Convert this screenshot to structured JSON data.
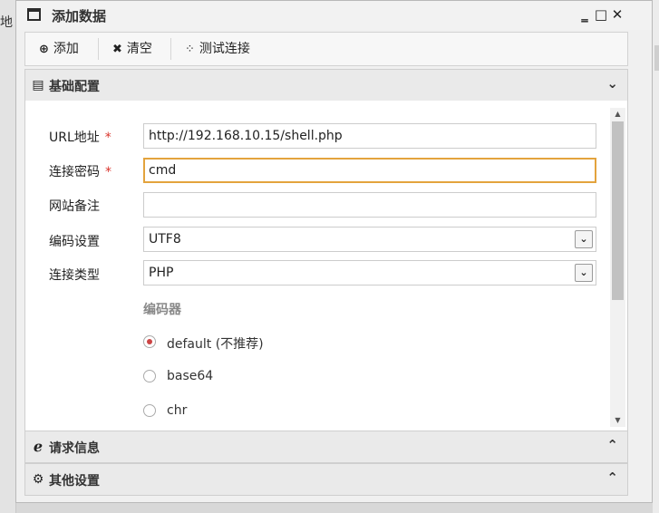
{
  "background": {
    "left_text": "地"
  },
  "window": {
    "title": "添加数据",
    "controls": {
      "minimize": "‗",
      "maximize": "□",
      "close": "✕"
    }
  },
  "toolbar": {
    "add": {
      "icon": "plus-circle-icon",
      "label": "添加"
    },
    "clear": {
      "icon": "x-icon",
      "label": "清空"
    },
    "test": {
      "icon": "spinner-icon",
      "label": "测试连接"
    }
  },
  "sections": {
    "basic": {
      "icon": "file-icon",
      "label": "基础配置",
      "state": "expanded"
    },
    "request": {
      "icon": "ie-icon",
      "label": "请求信息",
      "state": "collapsed"
    },
    "other": {
      "icon": "gears-icon",
      "label": "其他设置",
      "state": "collapsed"
    }
  },
  "form": {
    "url": {
      "label": "URL地址",
      "required_mark": "*",
      "value": "http://192.168.10.15/shell.php"
    },
    "password": {
      "label": "连接密码",
      "required_mark": "*",
      "value": "cmd"
    },
    "note": {
      "label": "网站备注",
      "value": ""
    },
    "encoding": {
      "label": "编码设置",
      "value": "UTF8"
    },
    "type": {
      "label": "连接类型",
      "value": "PHP"
    },
    "encoder": {
      "label": "编码器",
      "options": [
        {
          "label": "default (不推荐)",
          "checked": true
        },
        {
          "label": "base64",
          "checked": false
        },
        {
          "label": "chr",
          "checked": false
        }
      ]
    }
  },
  "colors": {
    "accent_focus": "#e3a33d",
    "required": "#d9342b"
  }
}
